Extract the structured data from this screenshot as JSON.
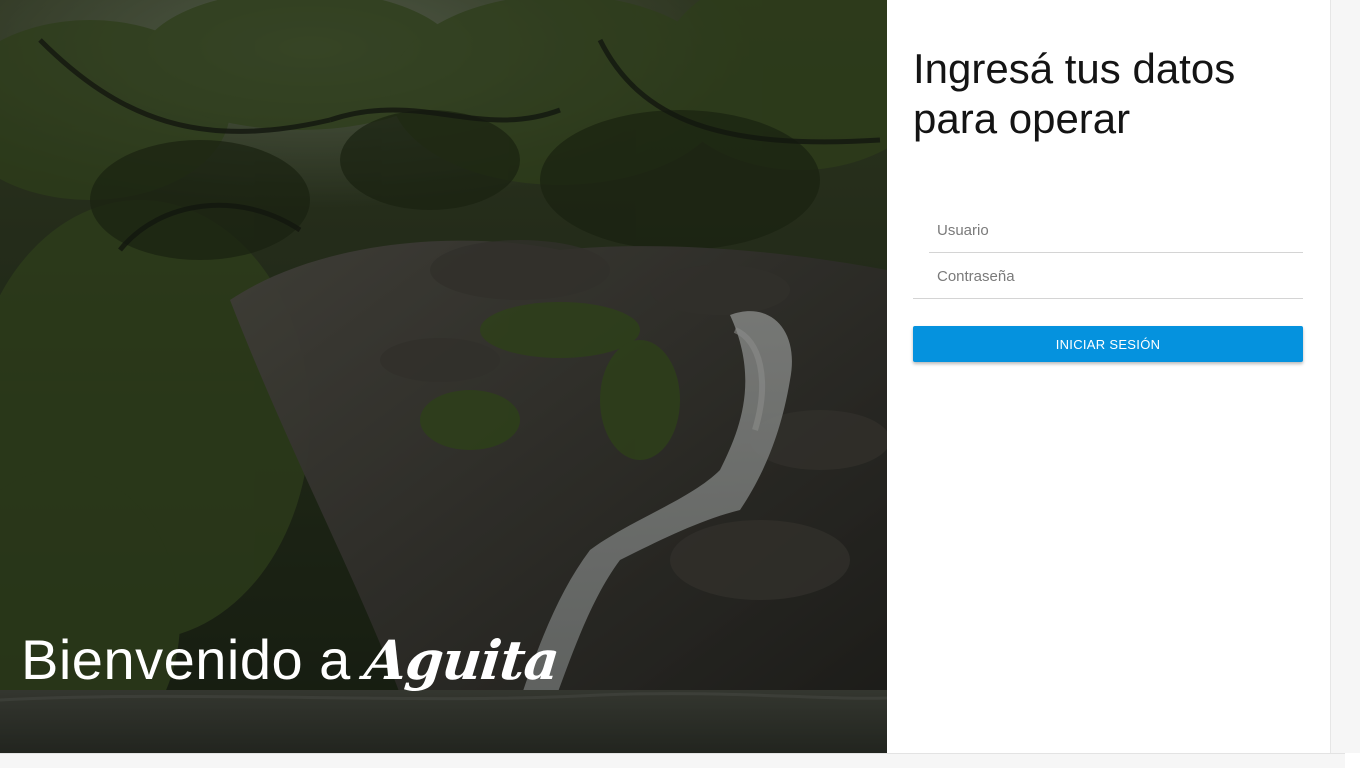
{
  "hero": {
    "welcome_text": "Bienvenido a",
    "brand_name": "Aguita",
    "background_icon": "waterfall-photo"
  },
  "login_form": {
    "title": "Ingresá tus datos para operar",
    "username": {
      "placeholder": "Usuario",
      "value": ""
    },
    "password": {
      "placeholder": "Contraseña",
      "value": ""
    },
    "submit_label": "INICIAR SESIÓN"
  },
  "colors": {
    "primary_button": "#0592de",
    "title_text": "#141414",
    "hero_overlay": "rgba(0,0,0,0.42)"
  }
}
